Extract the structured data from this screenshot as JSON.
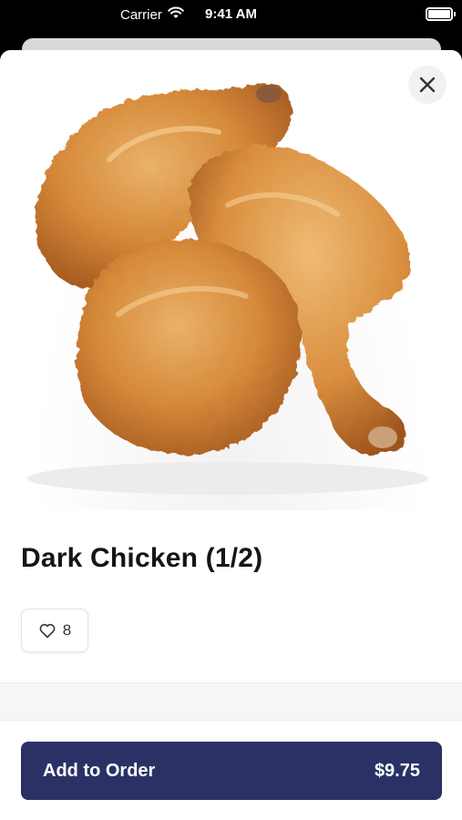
{
  "status_bar": {
    "carrier": "Carrier",
    "time": "9:41 AM"
  },
  "product": {
    "title": "Dark Chicken (1/2)",
    "likes": "8",
    "image_alt": "fried-chicken-photo"
  },
  "actions": {
    "add_label": "Add to Order",
    "price": "$9.75"
  },
  "colors": {
    "primary": "#2b3164",
    "chicken": "#d68a3a"
  },
  "icons": [
    "wifi-icon",
    "battery-icon",
    "close-icon",
    "heart-icon"
  ]
}
